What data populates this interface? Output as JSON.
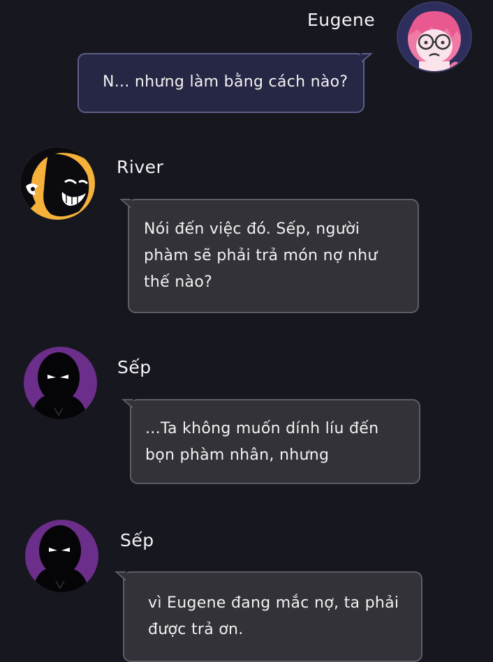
{
  "messages": [
    {
      "sender": "Eugene",
      "side": "right",
      "avatar": {
        "icon": "eugene-avatar",
        "color": "#f07aa6"
      },
      "text": "N... nhưng làm bằng cách nào?"
    },
    {
      "sender": "River",
      "side": "left",
      "avatar": {
        "icon": "river-avatar",
        "color": "#f5b13a"
      },
      "text": "Nói đến việc đó. Sếp, người\nphàm sẽ phải trả món nợ như\nthế nào?"
    },
    {
      "sender": "Sếp",
      "side": "left",
      "avatar": {
        "icon": "sep-avatar",
        "color": "#6b2e8a"
      },
      "text": "...Ta không muốn dính líu đến\nbọn phàm nhân, nhưng"
    },
    {
      "sender": "Sếp",
      "side": "left",
      "avatar": {
        "icon": "sep-avatar",
        "color": "#6b2e8a"
      },
      "text": "vì Eugene đang mắc nợ, ta phải\nđược trả ơn."
    }
  ]
}
